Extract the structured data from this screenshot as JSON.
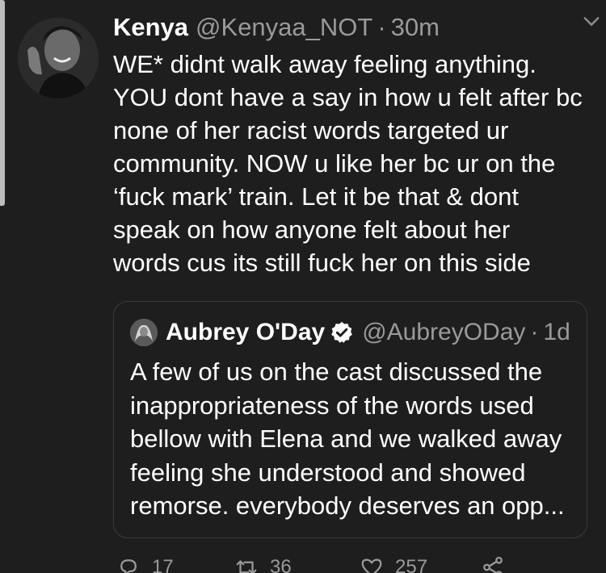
{
  "author": {
    "display_name": "Kenya",
    "handle": "@Kenyaa_NOT",
    "separator": "·",
    "time": "30m"
  },
  "tweet_lines": [
    "WE* didnt walk away feeling anything.",
    "YOU dont have a say in how u felt after bc",
    "none of her racist words targeted ur",
    "community. NOW u like her bc ur on the",
    "‘fuck mark’ train. Let it be that & dont",
    "speak on how anyone felt about her",
    "words cus its still fuck her on this side"
  ],
  "quoted": {
    "display_name": "Aubrey O'Day",
    "handle": "@AubreyODay",
    "separator": "·",
    "time": "1d",
    "lines": [
      "A few of us on the cast discussed the",
      "inappropriateness of the words used",
      "bellow with Elena and we walked away",
      "feeling she understood and showed",
      "remorse. everybody deserves an opp..."
    ]
  },
  "actions": {
    "reply_count": "17",
    "retweet_count": "36",
    "like_count": "257"
  },
  "icons": {
    "caret": "chevron-down-icon",
    "verified": "verified-badge-icon",
    "reply": "reply-icon",
    "retweet": "retweet-icon",
    "like": "heart-icon",
    "share": "share-icon"
  },
  "colors": {
    "background": "#1e1e1e",
    "text": "#ffffff",
    "secondary": "#9a9a9a",
    "border": "#3a3a3a"
  }
}
